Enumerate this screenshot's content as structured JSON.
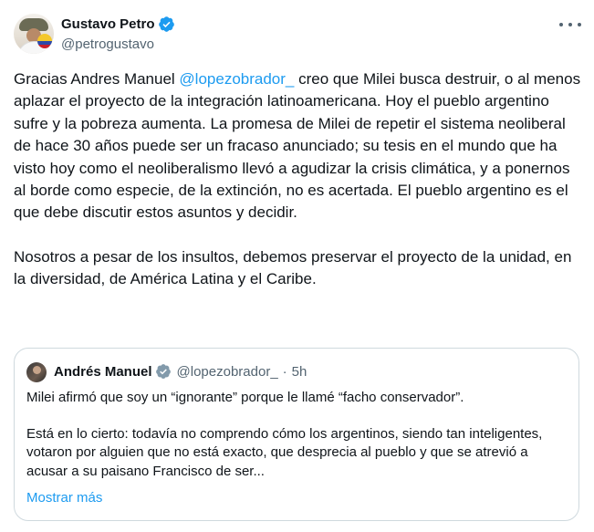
{
  "author": {
    "display_name": "Gustavo Petro",
    "handle": "@petrogustavo",
    "verified": true
  },
  "more_icon": "more-horizontal-icon",
  "tweet": {
    "mention": "@lopezobrador_",
    "paragraph1_before_mention": "Gracias Andres Manuel ",
    "paragraph1_after_mention": " creo que Milei busca destruir, o al menos aplazar el proyecto de la integración latinoamericana. Hoy el pueblo argentino sufre y la pobreza aumenta. La promesa de Milei de repetir el sistema neoliberal de hace 30 años puede ser un fracaso anunciado; su tesis en el mundo que ha visto hoy como el neoliberalismo llevó a agudizar la crisis climática, y a ponernos al borde como especie, de la extinción, no es acertada. El pueblo argentino es el que debe discutir estos asuntos y decidir.",
    "paragraph2": "Nosotros a pesar de los insultos, debemos preservar el proyecto de la unidad, en la diversidad, de América Latina y el Caribe."
  },
  "quoted_tweet": {
    "display_name": "Andrés Manuel",
    "handle": "@lopezobrador_",
    "separator": "·",
    "time": "5h",
    "verified": true,
    "paragraph1": "Milei afirmó que soy un “ignorante” porque le llamé “facho conservador”.",
    "paragraph2": "Está en lo cierto: todavía no comprendo cómo los argentinos, siendo tan inteligentes, votaron por alguien que no está exacto, que desprecia al pueblo y que se atrevió a acusar a su paisano Francisco de ser...",
    "show_more": "Mostrar más"
  },
  "colors": {
    "link": "#1d9bf0",
    "secondary_text": "#536471",
    "border": "#cfd9de"
  }
}
